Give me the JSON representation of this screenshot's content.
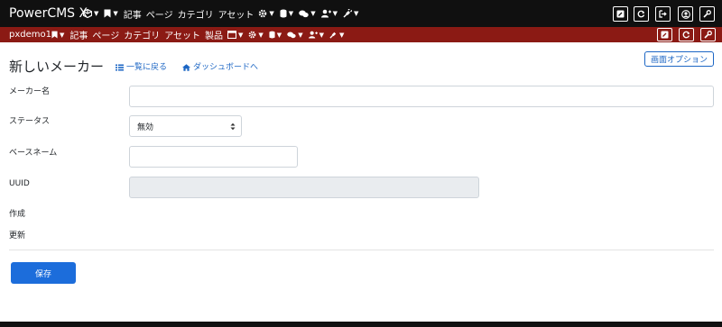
{
  "header": {
    "brand": "PowerCMS X",
    "menu": [
      "記事",
      "ページ",
      "カテゴリ",
      "アセット"
    ]
  },
  "sitebar": {
    "site_name": "pxdemo1",
    "menu": [
      "記事",
      "ページ",
      "カテゴリ",
      "アセット",
      "製品"
    ]
  },
  "page": {
    "title": "新しいメーカー",
    "back_to_list": "一覧に戻る",
    "to_dashboard": "ダッシュボードへ",
    "screen_options": "画面オプション"
  },
  "form": {
    "maker_name_label": "メーカー名",
    "maker_name_value": "",
    "status_label": "ステータス",
    "status_value": "無効",
    "basename_label": "ベースネーム",
    "basename_value": "",
    "uuid_label": "UUID",
    "uuid_value": "",
    "created_label": "作成",
    "updated_label": "更新",
    "save_label": "保存"
  },
  "icons": {
    "cube": "cube-icon",
    "bookmark": "bookmark-icon",
    "gear": "gear-icon",
    "database": "database-icon",
    "comments": "comments-icon",
    "users": "users-icon",
    "plug": "plug-icon",
    "edit": "edit-icon",
    "refresh": "refresh-icon",
    "sign-out": "sign-out-icon",
    "user": "user-icon",
    "wrench": "wrench-icon",
    "window": "window-icon",
    "list": "list-icon",
    "home": "home-icon"
  },
  "colors": {
    "topbar": "#101010",
    "sitebar": "#8b1a14",
    "link": "#1c66c4",
    "primary": "#1c6ddb"
  }
}
